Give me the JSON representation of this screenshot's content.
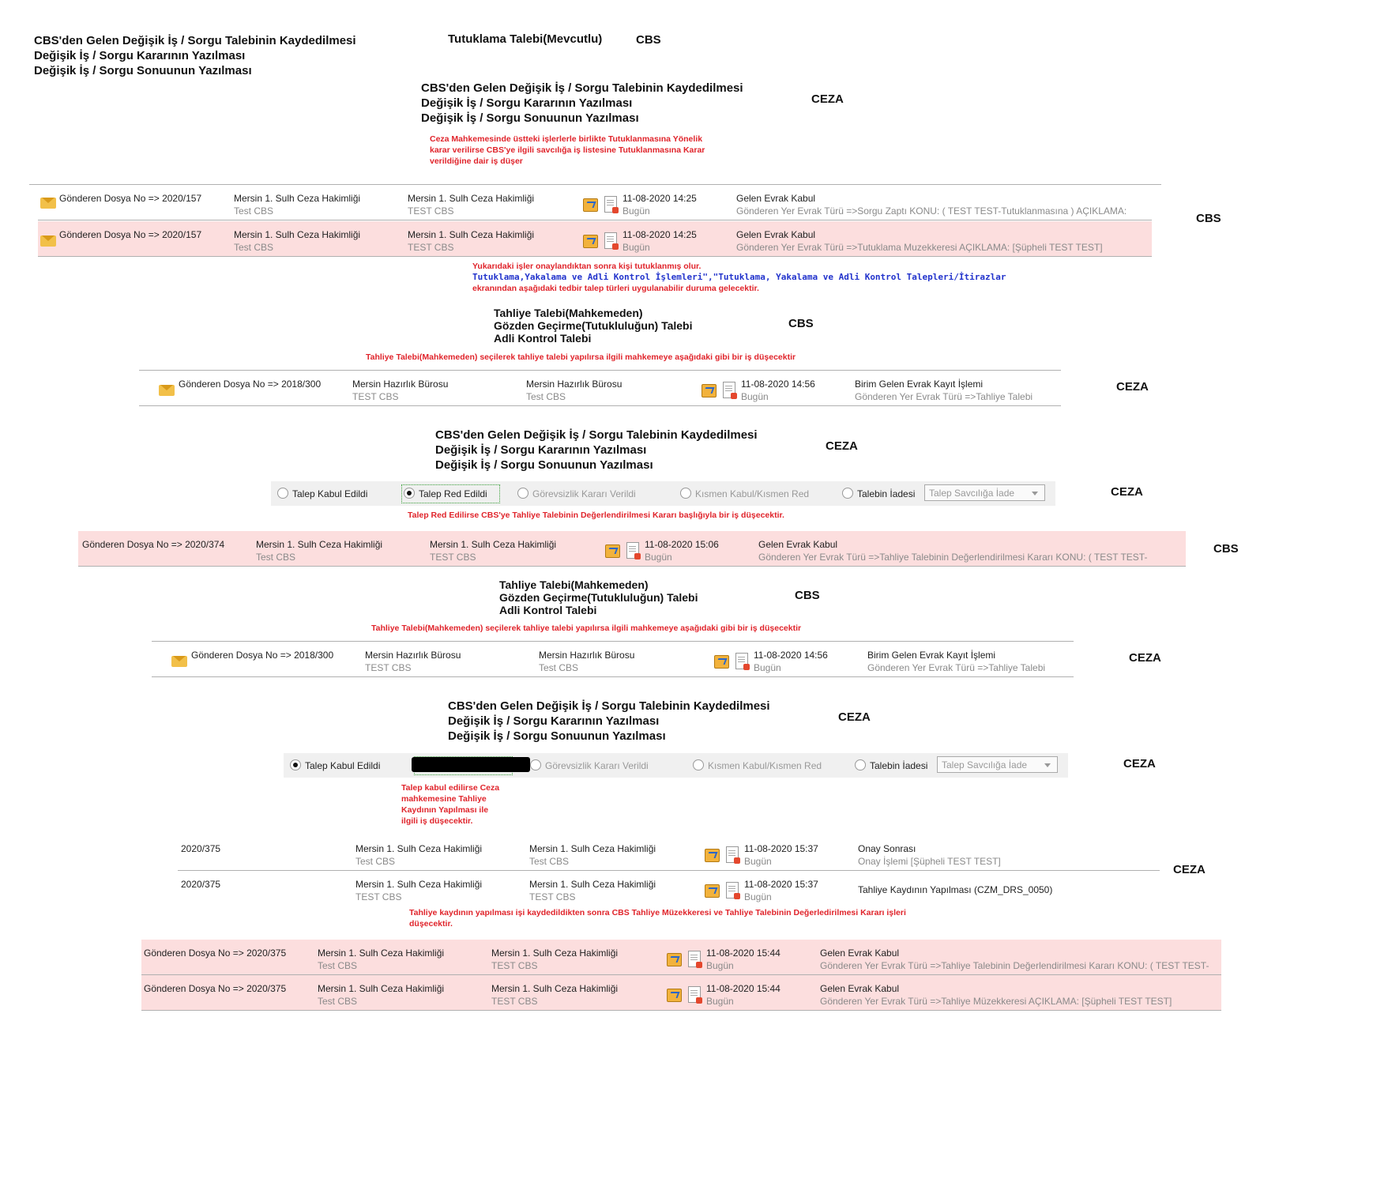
{
  "headings": {
    "top_left": [
      "CBS'den Gelen Değişik İş / Sorgu Talebinin Kaydedilmesi",
      "Değişik İş / Sorgu Kararının Yazılması",
      "Değişik İş / Sorgu Sonuunun Yazılması"
    ],
    "top_center": "Tutuklama Talebi(Mevcutlu)",
    "cbs_label": "CBS",
    "ceza_label": "CEZA",
    "ceza_block": [
      "CBS'den Gelen Değişik İş / Sorgu Talebinin Kaydedilmesi",
      "Değişik İş / Sorgu Kararının Yazılması",
      "Değişik İş / Sorgu Sonuunun Yazılması"
    ],
    "tahliye_block": [
      "Tahliye Talebi(Mahkemeden)",
      "Gözden Geçirme(Tutukluluğun) Talebi",
      "Adli Kontrol Talebi"
    ]
  },
  "notes": {
    "note1": [
      "Ceza Mahkemesinde üstteki işlerlerle birlikte Tutuklanmasına Yönelik",
      "karar verilirse CBS'ye ilgili savcılığa iş listesine Tutuklanmasına Karar",
      "verildiğine dair iş düşer"
    ],
    "note2_line1": "Yukarıdaki işler onaylandıktan sonra kişi tutuklanmış olur.",
    "note2_line2": "Tutuklama,Yakalama ve Adli Kontrol İşlemleri\",\"Tutuklama, Yakalama ve Adli Kontrol Talepleri/İtirazlar",
    "note2_line3": "ekranından aşağıdaki tedbir talep türleri uygulanabilir duruma gelecektir.",
    "note3": "Tahliye Talebi(Mahkemeden) seçilerek tahliye talebi yapılırsa ilgili mahkemeye aşağıdaki gibi bir iş düşecektir",
    "note4": "Talep Red Edilirse CBS'ye Tahliye Talebinin Değerlendirilmesi Kararı başlığıyla bir iş düşecektir.",
    "note5": [
      "Talep kabul edilirse Ceza",
      "mahkemesine Tahliye",
      "Kaydının Yapılması ile",
      "ilgili iş düşecektir."
    ],
    "note6": [
      "Tahliye kaydının yapılması işi kaydedildikten sonra CBS Tahliye Müzekkeresi ve Tahliye Talebinin Değerledirilmesi Kararı işleri",
      "düşecektir."
    ]
  },
  "rows": {
    "r1": {
      "dosya": "Gönderen Dosya No => 2020/157",
      "c2a": "Mersin 1. Sulh Ceza Hakimliği",
      "c2b": "Test CBS",
      "c3a": "Mersin 1. Sulh Ceza Hakimliği",
      "c3b": "TEST CBS",
      "date": "11-08-2020 14:25",
      "day": "Bugün",
      "t1": "Gelen Evrak Kabul",
      "t2": "Gönderen Yer Evrak Türü =>Sorgu Zaptı KONU: ( TEST TEST-Tutuklanmasına ) AÇIKLAMA:"
    },
    "r2": {
      "dosya": "Gönderen Dosya No => 2020/157",
      "c2a": "Mersin 1. Sulh Ceza Hakimliği",
      "c2b": "Test CBS",
      "c3a": "Mersin 1. Sulh Ceza Hakimliği",
      "c3b": "TEST CBS",
      "date": "11-08-2020 14:25",
      "day": "Bugün",
      "t1": "Gelen Evrak Kabul",
      "t2": "Gönderen Yer Evrak Türü =>Tutuklama Muzekkeresi AÇIKLAMA: [Şüpheli TEST TEST]"
    },
    "r3": {
      "dosya": "Gönderen Dosya No => 2018/300",
      "c2a": "Mersin Hazırlık Bürosu",
      "c2b": "TEST CBS",
      "c3a": "Mersin Hazırlık Bürosu",
      "c3b": "Test CBS",
      "date": "11-08-2020 14:56",
      "day": "Bugün",
      "t1": "Birim Gelen Evrak Kayıt İşlemi",
      "t2": "Gönderen Yer Evrak Türü =>Tahliye Talebi"
    },
    "r4": {
      "dosya": "Gönderen Dosya No => 2020/374",
      "c2a": "Mersin 1. Sulh Ceza Hakimliği",
      "c2b": "Test CBS",
      "c3a": "Mersin 1. Sulh Ceza Hakimliği",
      "c3b": "TEST CBS",
      "date": "11-08-2020 15:06",
      "day": "Bugün",
      "t1": "Gelen Evrak Kabul",
      "t2": "Gönderen Yer Evrak Türü =>Tahliye Talebinin Değerlendirilmesi Kararı KONU: ( TEST TEST-"
    },
    "r5": {
      "dosya": "Gönderen Dosya No => 2018/300",
      "c2a": "Mersin Hazırlık Bürosu",
      "c2b": "TEST CBS",
      "c3a": "Mersin Hazırlık Bürosu",
      "c3b": "Test CBS",
      "date": "11-08-2020 14:56",
      "day": "Bugün",
      "t1": "Birim Gelen Evrak Kayıt İşlemi",
      "t2": "Gönderen Yer Evrak Türü =>Tahliye Talebi"
    },
    "r6": {
      "dosya": "2020/375",
      "c2a": "Mersin 1. Sulh Ceza Hakimliği",
      "c2b": "Test CBS",
      "c3a": "Mersin 1. Sulh Ceza Hakimliği",
      "c3b": "Test CBS",
      "date": "11-08-2020 15:37",
      "day": "Bugün",
      "t1": "Onay Sonrası",
      "t2": "Onay İşlemi [Şüpheli TEST TEST]"
    },
    "r7": {
      "dosya": "2020/375",
      "c2a": "Mersin 1. Sulh Ceza Hakimliği",
      "c2b": "TEST CBS",
      "c3a": "Mersin 1. Sulh Ceza Hakimliği",
      "c3b": "TEST CBS",
      "date": "11-08-2020 15:37",
      "day": "Bugün",
      "t1": "Tahliye Kaydının Yapılması (CZM_DRS_0050)"
    },
    "r8": {
      "dosya": "Gönderen Dosya No => 2020/375",
      "c2a": "Mersin 1. Sulh Ceza Hakimliği",
      "c2b": "Test CBS",
      "c3a": "Mersin 1. Sulh Ceza Hakimliği",
      "c3b": "TEST CBS",
      "date": "11-08-2020 15:44",
      "day": "Bugün",
      "t1": "Gelen Evrak Kabul",
      "t2": "Gönderen Yer Evrak Türü =>Tahliye Talebinin Değerlendirilmesi Kararı KONU: ( TEST TEST-"
    },
    "r9": {
      "dosya": "Gönderen Dosya No => 2020/375",
      "c2a": "Mersin 1. Sulh Ceza Hakimliği",
      "c2b": "Test CBS",
      "c3a": "Mersin 1. Sulh Ceza Hakimliği",
      "c3b": "TEST CBS",
      "date": "11-08-2020 15:44",
      "day": "Bugün",
      "t1": "Gelen Evrak Kabul",
      "t2": "Gönderen Yer Evrak Türü =>Tahliye Müzekkeresi AÇIKLAMA: [Şüpheli TEST TEST]"
    }
  },
  "radios": {
    "kabul": "Talep Kabul Edildi",
    "red": "Talep Red Edildi",
    "gorevsizlik": "Görevsizlik Kararı Verildi",
    "kismen": "Kısmen Kabul/Kısmen Red",
    "iade": "Talebin İadesi",
    "select_value": "Talep Savcılığa İade",
    "bar1_selected": "red",
    "bar2_selected": "kabul"
  },
  "colors": {
    "pink_row": "#fcdede",
    "note_red": "#e0242b",
    "note_blue": "#2233cc"
  }
}
